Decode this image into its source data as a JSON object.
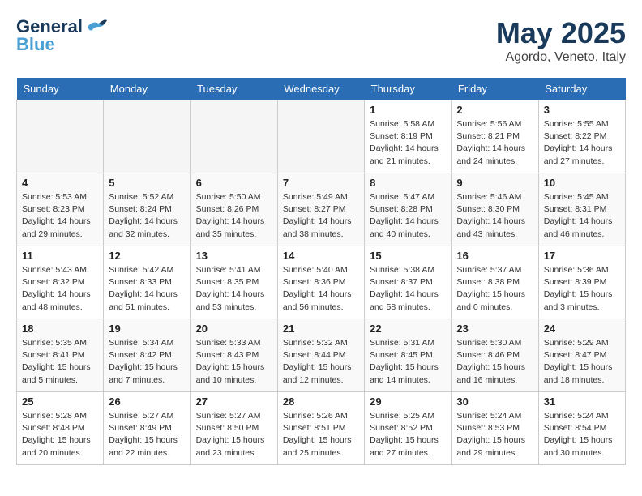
{
  "header": {
    "logo_line1": "General",
    "logo_line2": "Blue",
    "month": "May 2025",
    "location": "Agordo, Veneto, Italy"
  },
  "weekdays": [
    "Sunday",
    "Monday",
    "Tuesday",
    "Wednesday",
    "Thursday",
    "Friday",
    "Saturday"
  ],
  "rows": [
    {
      "style": "row-white",
      "cells": [
        {
          "empty": true
        },
        {
          "empty": true
        },
        {
          "empty": true
        },
        {
          "empty": true
        },
        {
          "day": "1",
          "info": "Sunrise: 5:58 AM\nSunset: 8:19 PM\nDaylight: 14 hours\nand 21 minutes."
        },
        {
          "day": "2",
          "info": "Sunrise: 5:56 AM\nSunset: 8:21 PM\nDaylight: 14 hours\nand 24 minutes."
        },
        {
          "day": "3",
          "info": "Sunrise: 5:55 AM\nSunset: 8:22 PM\nDaylight: 14 hours\nand 27 minutes."
        }
      ]
    },
    {
      "style": "row-gray",
      "cells": [
        {
          "day": "4",
          "info": "Sunrise: 5:53 AM\nSunset: 8:23 PM\nDaylight: 14 hours\nand 29 minutes."
        },
        {
          "day": "5",
          "info": "Sunrise: 5:52 AM\nSunset: 8:24 PM\nDaylight: 14 hours\nand 32 minutes."
        },
        {
          "day": "6",
          "info": "Sunrise: 5:50 AM\nSunset: 8:26 PM\nDaylight: 14 hours\nand 35 minutes."
        },
        {
          "day": "7",
          "info": "Sunrise: 5:49 AM\nSunset: 8:27 PM\nDaylight: 14 hours\nand 38 minutes."
        },
        {
          "day": "8",
          "info": "Sunrise: 5:47 AM\nSunset: 8:28 PM\nDaylight: 14 hours\nand 40 minutes."
        },
        {
          "day": "9",
          "info": "Sunrise: 5:46 AM\nSunset: 8:30 PM\nDaylight: 14 hours\nand 43 minutes."
        },
        {
          "day": "10",
          "info": "Sunrise: 5:45 AM\nSunset: 8:31 PM\nDaylight: 14 hours\nand 46 minutes."
        }
      ]
    },
    {
      "style": "row-white",
      "cells": [
        {
          "day": "11",
          "info": "Sunrise: 5:43 AM\nSunset: 8:32 PM\nDaylight: 14 hours\nand 48 minutes."
        },
        {
          "day": "12",
          "info": "Sunrise: 5:42 AM\nSunset: 8:33 PM\nDaylight: 14 hours\nand 51 minutes."
        },
        {
          "day": "13",
          "info": "Sunrise: 5:41 AM\nSunset: 8:35 PM\nDaylight: 14 hours\nand 53 minutes."
        },
        {
          "day": "14",
          "info": "Sunrise: 5:40 AM\nSunset: 8:36 PM\nDaylight: 14 hours\nand 56 minutes."
        },
        {
          "day": "15",
          "info": "Sunrise: 5:38 AM\nSunset: 8:37 PM\nDaylight: 14 hours\nand 58 minutes."
        },
        {
          "day": "16",
          "info": "Sunrise: 5:37 AM\nSunset: 8:38 PM\nDaylight: 15 hours\nand 0 minutes."
        },
        {
          "day": "17",
          "info": "Sunrise: 5:36 AM\nSunset: 8:39 PM\nDaylight: 15 hours\nand 3 minutes."
        }
      ]
    },
    {
      "style": "row-gray",
      "cells": [
        {
          "day": "18",
          "info": "Sunrise: 5:35 AM\nSunset: 8:41 PM\nDaylight: 15 hours\nand 5 minutes."
        },
        {
          "day": "19",
          "info": "Sunrise: 5:34 AM\nSunset: 8:42 PM\nDaylight: 15 hours\nand 7 minutes."
        },
        {
          "day": "20",
          "info": "Sunrise: 5:33 AM\nSunset: 8:43 PM\nDaylight: 15 hours\nand 10 minutes."
        },
        {
          "day": "21",
          "info": "Sunrise: 5:32 AM\nSunset: 8:44 PM\nDaylight: 15 hours\nand 12 minutes."
        },
        {
          "day": "22",
          "info": "Sunrise: 5:31 AM\nSunset: 8:45 PM\nDaylight: 15 hours\nand 14 minutes."
        },
        {
          "day": "23",
          "info": "Sunrise: 5:30 AM\nSunset: 8:46 PM\nDaylight: 15 hours\nand 16 minutes."
        },
        {
          "day": "24",
          "info": "Sunrise: 5:29 AM\nSunset: 8:47 PM\nDaylight: 15 hours\nand 18 minutes."
        }
      ]
    },
    {
      "style": "row-white",
      "cells": [
        {
          "day": "25",
          "info": "Sunrise: 5:28 AM\nSunset: 8:48 PM\nDaylight: 15 hours\nand 20 minutes."
        },
        {
          "day": "26",
          "info": "Sunrise: 5:27 AM\nSunset: 8:49 PM\nDaylight: 15 hours\nand 22 minutes."
        },
        {
          "day": "27",
          "info": "Sunrise: 5:27 AM\nSunset: 8:50 PM\nDaylight: 15 hours\nand 23 minutes."
        },
        {
          "day": "28",
          "info": "Sunrise: 5:26 AM\nSunset: 8:51 PM\nDaylight: 15 hours\nand 25 minutes."
        },
        {
          "day": "29",
          "info": "Sunrise: 5:25 AM\nSunset: 8:52 PM\nDaylight: 15 hours\nand 27 minutes."
        },
        {
          "day": "30",
          "info": "Sunrise: 5:24 AM\nSunset: 8:53 PM\nDaylight: 15 hours\nand 29 minutes."
        },
        {
          "day": "31",
          "info": "Sunrise: 5:24 AM\nSunset: 8:54 PM\nDaylight: 15 hours\nand 30 minutes."
        }
      ]
    }
  ]
}
